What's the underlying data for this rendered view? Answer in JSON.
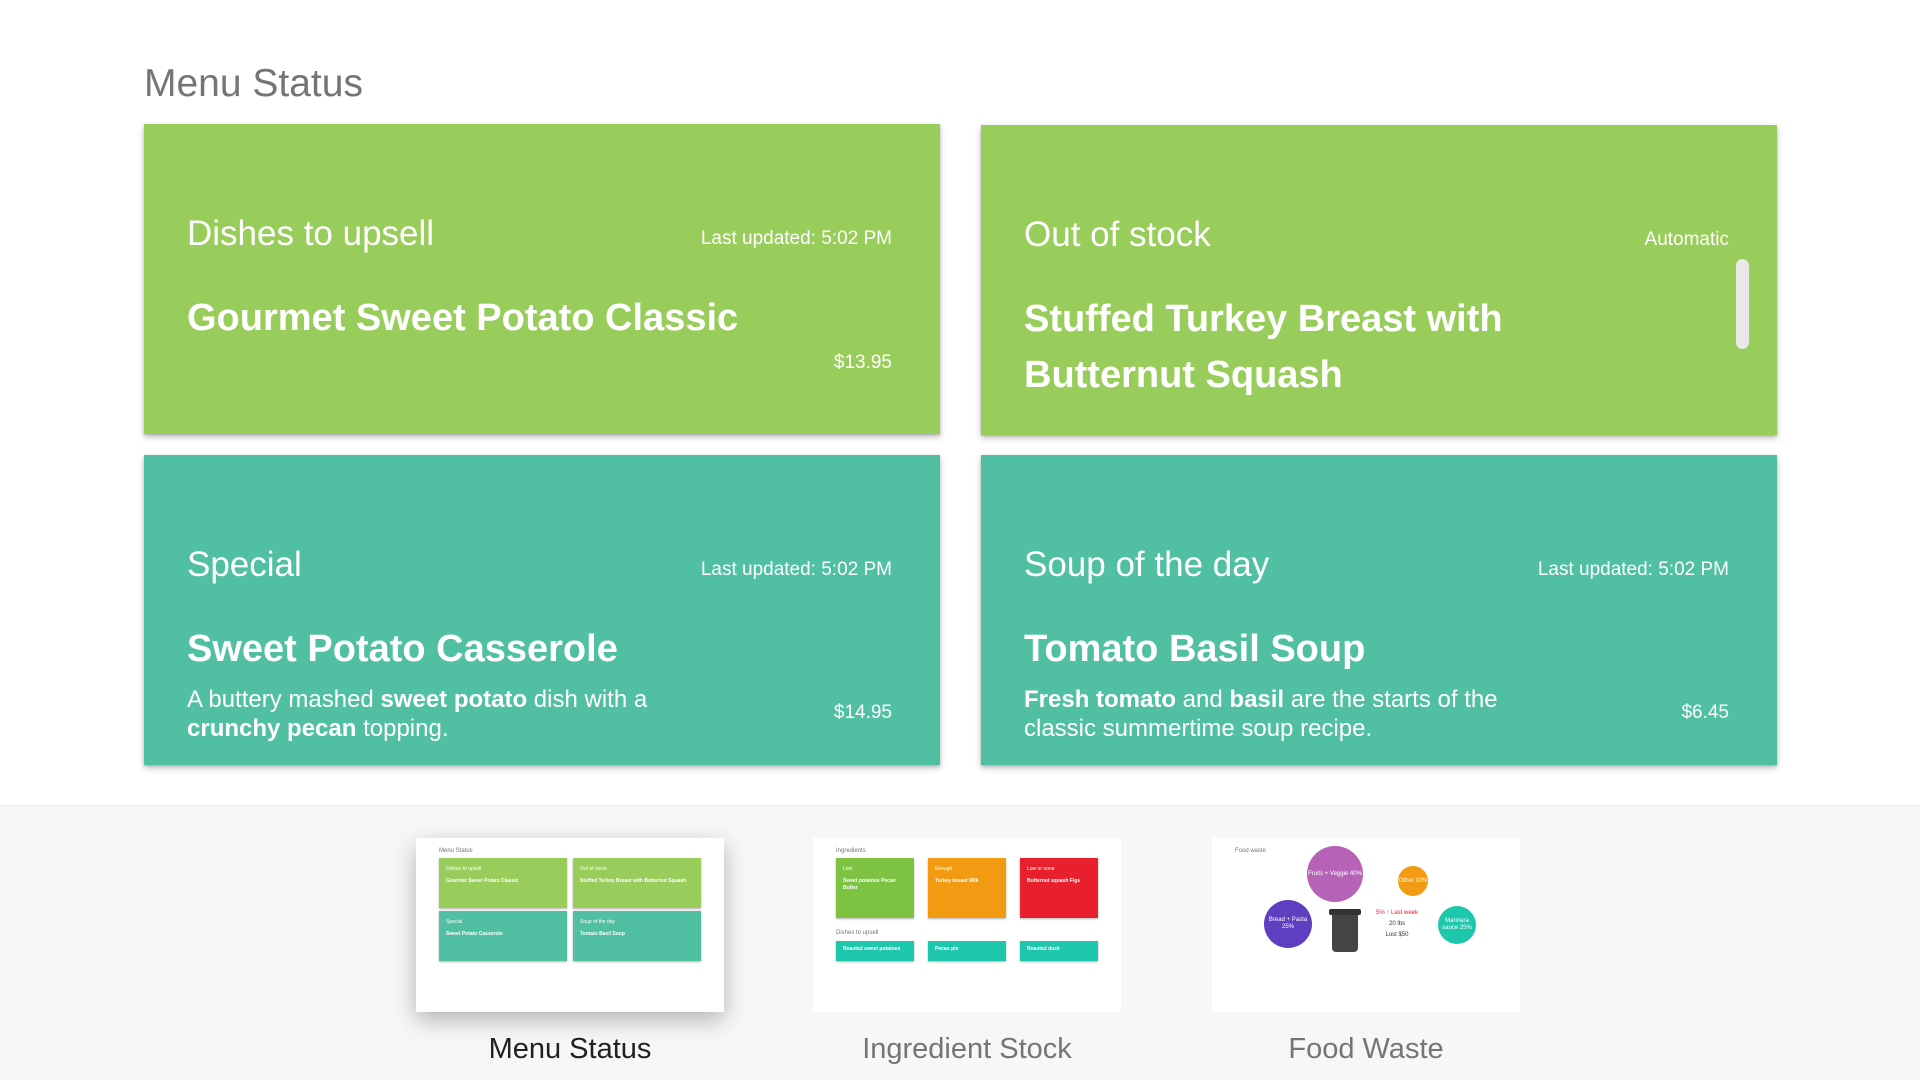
{
  "page": {
    "title": "Menu Status"
  },
  "cards": [
    {
      "category": "Dishes to upsell",
      "meta": "Last updated: 5:02 PM",
      "dish": "Gourmet Sweet Potato Classic",
      "price": "$13.95"
    },
    {
      "category": "Out of stock",
      "meta": "Automatic",
      "dish": "Stuffed Turkey Breast with Butternut Squash"
    },
    {
      "category": "Special",
      "meta": "Last updated: 5:02 PM",
      "dish": "Sweet Potato Casserole",
      "desc": [
        {
          "t": "A buttery mashed ",
          "b": false
        },
        {
          "t": "sweet potato",
          "b": true
        },
        {
          "t": " dish with a ",
          "b": false
        },
        {
          "t": "crunchy pecan",
          "b": true
        },
        {
          "t": " topping.",
          "b": false
        }
      ],
      "price": "$14.95"
    },
    {
      "category": "Soup of the day",
      "meta": "Last updated: 5:02 PM",
      "dish": "Tomato Basil Soup",
      "desc": [
        {
          "t": "Fresh tomato",
          "b": true
        },
        {
          "t": " and ",
          "b": false
        },
        {
          "t": "basil",
          "b": true
        },
        {
          "t": " are the starts of the classic summertime soup recipe.",
          "b": false
        }
      ],
      "price": "$6.45"
    }
  ],
  "tray": {
    "items": [
      {
        "label": "Menu Status",
        "active": true
      },
      {
        "label": "Ingredient Stock",
        "active": false
      },
      {
        "label": "Food Waste",
        "active": false
      }
    ]
  },
  "thumb_menu": {
    "title": "Menu Status",
    "cards": [
      {
        "h": "Dishes to upsell",
        "b": "Gourmet Sweet Potato Classic"
      },
      {
        "h": "Out of stock",
        "b": "Stuffed Turkey Breast with Butternut Squash"
      },
      {
        "h": "Special",
        "b": "Sweet Potato Casserole"
      },
      {
        "h": "Soup of the day",
        "b": "Tomato Basil Soup"
      }
    ]
  },
  "thumb_ingredients": {
    "title": "Ingredients",
    "cards": [
      {
        "h": "Lots",
        "b": "Sweet potatoes Pecan Butter"
      },
      {
        "h": "Enough",
        "b": "Turkey breast Milk"
      },
      {
        "h": "Low or none",
        "b": "Butternut squash Figs"
      }
    ],
    "upsell_title": "Dishes to upsell",
    "upsell": [
      "Roasted sweet potatoes",
      "Pecan pie",
      "Roasted duck"
    ]
  },
  "thumb_waste": {
    "title": "Food waste",
    "bubbles": [
      {
        "label": "Fruits + Veggie 40%",
        "color": "#b663b7"
      },
      {
        "label": "Other 10%",
        "color": "#f29b12"
      },
      {
        "label": "Bread + Pasta 25%",
        "color": "#5e3fbf"
      },
      {
        "label": "Marinara sauce 25%",
        "color": "#1ec6ab"
      }
    ],
    "stat_change": "5% ↑ Last week",
    "stat_weight": "20 lbs",
    "stat_lost": "Lost $50"
  },
  "colors": {
    "green": "#99cd5b",
    "teal": "#50bfa2",
    "title_gray": "#757575"
  }
}
